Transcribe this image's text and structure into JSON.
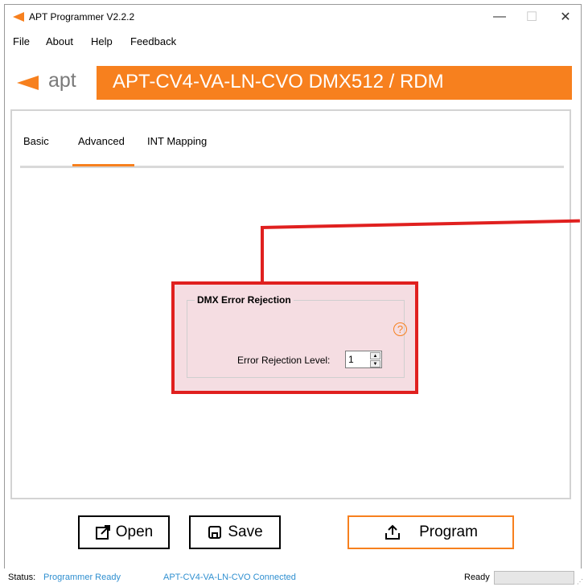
{
  "window": {
    "title": "APT Programmer V2.2.2",
    "controls": {
      "minimize": "—",
      "maximize": "☐",
      "close": "✕"
    }
  },
  "menu": [
    "File",
    "About",
    "Help",
    "Feedback"
  ],
  "brand": {
    "name": "apt",
    "device_title": "APT-CV4-VA-LN-CVO DMX512 / RDM",
    "accent": "#f7801e"
  },
  "tabs": [
    {
      "label": "Basic",
      "active": false
    },
    {
      "label": "Advanced",
      "active": true
    },
    {
      "label": "INT Mapping",
      "active": false
    }
  ],
  "dmx_group": {
    "title": "DMX Error Rejection",
    "help_icon": "?",
    "field_label": "Error Rejection Level:",
    "value": "1",
    "spin_up": "▲",
    "spin_down": "▼"
  },
  "buttons": {
    "open": "Open",
    "save": "Save",
    "program": "Program"
  },
  "status": {
    "label": "Status:",
    "value": "Programmer Ready",
    "connection": "APT-CV4-VA-LN-CVO Connected",
    "ready": "Ready"
  },
  "colors": {
    "callout": "#e0201f",
    "status_blue": "#2f8fd0"
  }
}
